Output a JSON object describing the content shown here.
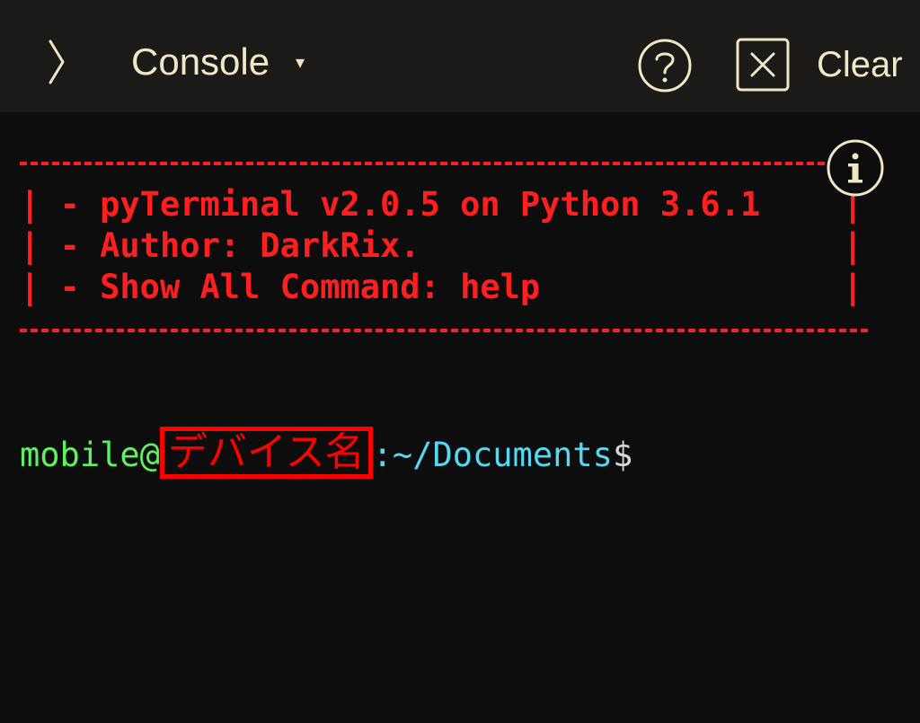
{
  "toolbar": {
    "title": "Console",
    "caret": "▾",
    "clear_label": "Clear"
  },
  "icons": {
    "chevron": "chevron-right-icon",
    "help": "question-circle-icon",
    "close": "close-square-icon",
    "info": "info-circle-icon"
  },
  "banner": {
    "lines": [
      "- pyTerminal v2.0.5 on Python 3.6.1",
      "- Author: DarkRix.",
      "- Show All Command: help"
    ],
    "border_char": "|"
  },
  "prompt": {
    "user": "mobile@",
    "host": "デバイス名",
    "path": ":~/Documents",
    "symbol": "$"
  },
  "colors": {
    "toolbar_bg": "#1c1a19",
    "terminal_bg": "#0d0d0d",
    "accent_text": "#efe8c6",
    "banner_red": "#ff1f1f",
    "prompt_green": "#5ef25e",
    "prompt_cyan": "#55d8f0"
  }
}
